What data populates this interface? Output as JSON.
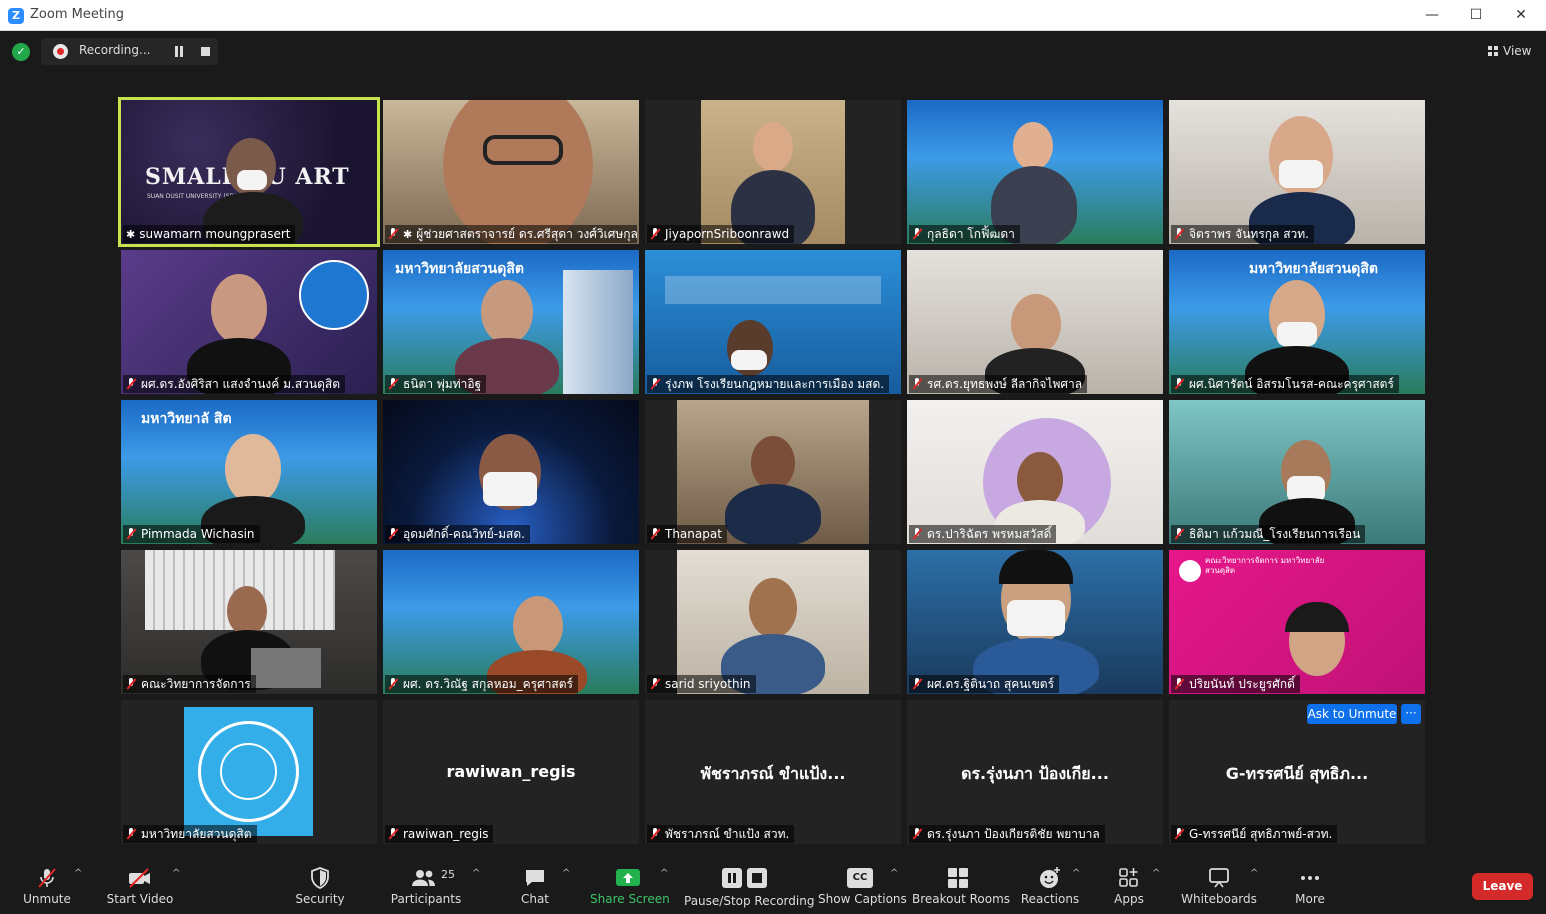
{
  "window": {
    "title": "Zoom Meeting",
    "app_icon": "zoom-logo"
  },
  "meeting_bar": {
    "security_badge": "shield-check-icon",
    "recording_label": "Recording...",
    "view_label": "View"
  },
  "tiles": [
    {
      "name": "suwamarn moungprasert",
      "muted": false,
      "pinned": true,
      "active_speaker": true,
      "bg_text": "SMALL BU ART",
      "bg_subtext": "SUAN DUSIT UNIVERSITY (SDU)"
    },
    {
      "name": "ผู้ช่วยศาสตราจารย์ ดร.ศรีสุดา วงศ์วิเศษกุล",
      "muted": true,
      "pinned": true
    },
    {
      "name": "JiyapornSriboonrawd",
      "muted": true
    },
    {
      "name": "กุลธิดา โกฟิ้ฒดา",
      "muted": true
    },
    {
      "name": "จิตราพร จันทรกุล สวท.",
      "muted": true
    },
    {
      "name": "ผศ.ดร.อังศิริสา แสงจำนงค์ ม.สวนดุสิต",
      "muted": true
    },
    {
      "name": "ธนิตา พุ่มท่าอิฐ",
      "muted": true,
      "bg_text": "มหาวิทยาลัยสวนดุสิต"
    },
    {
      "name": "รุ่งภพ โรงเรียนกฎหมายและการเมือง มสด.",
      "muted": true
    },
    {
      "name": "รศ.ดร.ยุทธพงษ์ ลีลากิจไพศาล",
      "muted": true
    },
    {
      "name": "ผศ.นิศารัตน์ อิสรมโนรส-คณะครุศาสตร์",
      "muted": true,
      "bg_text": "มหาวิทยาลัยสวนดุสิต"
    },
    {
      "name": "Pimmada Wichasin",
      "muted": true,
      "bg_text": "มหาวิทยาลั สิต"
    },
    {
      "name": "อุดมศักดิ์-คณวิทย์-มสด.",
      "muted": true
    },
    {
      "name": "Thanapat",
      "muted": true
    },
    {
      "name": "ดร.ปาริฉัตร พรหมสวัสดิ์",
      "muted": true
    },
    {
      "name": "ธิติมา แก้วมณี_โรงเรียนการเรือน",
      "muted": true
    },
    {
      "name": "คณะวิทยาการจัดการ",
      "muted": true
    },
    {
      "name": "ผศ. ดร.วิณัฐ สกุลหอม_ครุศาสตร์",
      "muted": true
    },
    {
      "name": "sarid sriyothin",
      "muted": true
    },
    {
      "name": "ผศ.ดร.ฐิตินาถ สุคนเขตร์",
      "muted": true
    },
    {
      "name": "ปริยนันท์ ประยูรศักดิ์",
      "muted": true,
      "bg_text": "คณะวิทยาการจัดการ มหาวิทยาลัยสวนดุสิต"
    },
    {
      "name": "มหาวิทยาลัยสวนดุสิต",
      "muted": true,
      "video_off": true,
      "logo": "suan-dusit-university-logo"
    },
    {
      "name": "rawiwan_regis",
      "muted": true,
      "video_off": true,
      "display": "rawiwan_regis"
    },
    {
      "name": "พัชราภรณ์ ขำแป้ง สวท.",
      "muted": true,
      "video_off": true,
      "display": "พัชราภรณ์ ขำแป้ง..."
    },
    {
      "name": "ดร.รุ่งนภา ป้องเกียรติชัย พยาบาล",
      "muted": true,
      "video_off": true,
      "display": "ดร.รุ่งนภา ป้องเกีย..."
    },
    {
      "name": "G-ทรรศนีย์ สุทธิภาพย์-สวท.",
      "muted": true,
      "video_off": true,
      "display": "G-ทรรศนีย์ สุทธิภ...",
      "ask_unmute_label": "Ask to Unmute",
      "more_label": "···"
    }
  ],
  "toolbar": {
    "unmute": "Unmute",
    "start_video": "Start Video",
    "security": "Security",
    "participants": "Participants",
    "participants_count": "25",
    "chat": "Chat",
    "share_screen": "Share Screen",
    "pause_stop_recording": "Pause/Stop Recording",
    "show_captions": "Show Captions",
    "captions_icon_text": "CC",
    "breakout_rooms": "Breakout Rooms",
    "reactions": "Reactions",
    "apps": "Apps",
    "whiteboards": "Whiteboards",
    "more": "More",
    "leave": "Leave"
  },
  "colors": {
    "accent_blue": "#0e71eb",
    "share_green": "#22b14c",
    "leave_red": "#d52a2a",
    "active_outline": "#c7e44c"
  }
}
